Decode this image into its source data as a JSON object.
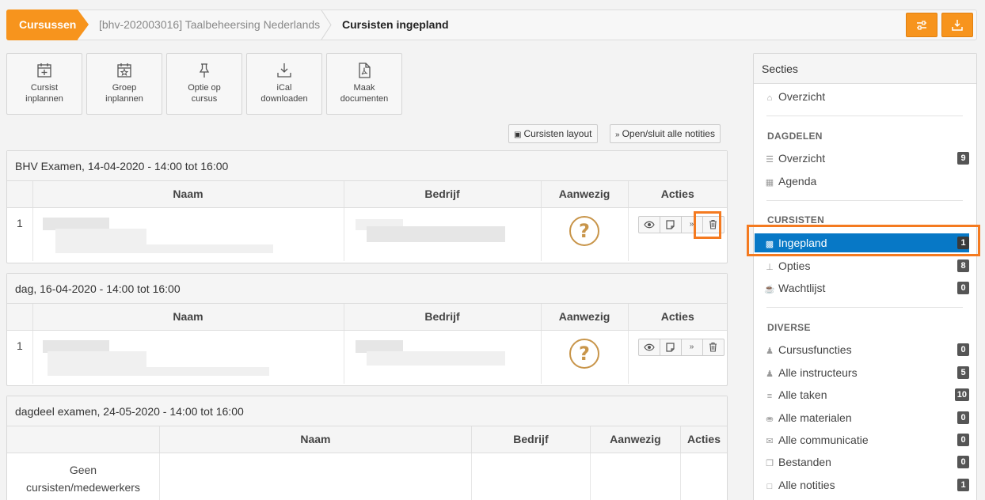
{
  "breadcrumb": {
    "home": "Cursussen",
    "course": "[bhv-202003016] Taalbeheersing Nederlands",
    "current": "Cursisten ingepland"
  },
  "toolbar": [
    {
      "icon": "calendar-plus-icon",
      "line1": "Cursist",
      "line2": "inplannen"
    },
    {
      "icon": "calendar-star-icon",
      "line1": "Groep",
      "line2": "inplannen"
    },
    {
      "icon": "pin-icon",
      "line1": "Optie op",
      "line2": "cursus"
    },
    {
      "icon": "download-icon",
      "line1": "iCal",
      "line2": "downloaden"
    },
    {
      "icon": "pdf-icon",
      "line1": "Maak",
      "line2": "documenten"
    }
  ],
  "actions": {
    "layout": "Cursisten layout",
    "notes": "Open/sluit alle notities"
  },
  "table_headers": {
    "name": "Naam",
    "company": "Bedrijf",
    "present": "Aanwezig",
    "actions": "Acties"
  },
  "sections": [
    {
      "title": "BHV Examen, 14-04-2020 - 14:00 tot 16:00",
      "row_index": "1",
      "present_symbol": "?"
    },
    {
      "title": "dag, 16-04-2020 - 14:00 tot 16:00",
      "row_index": "1",
      "present_symbol": "?"
    },
    {
      "title": "dagdeel examen, 24-05-2020 - 14:00 tot 16:00",
      "empty_text": "Geen cursisten/medewerkers"
    }
  ],
  "sidebar": {
    "title": "Secties",
    "overview": "Overzicht",
    "cat_dagdelen": "DAGDELEN",
    "dagdelen": [
      {
        "label": "Overzicht",
        "badge": "9",
        "icon": "list-icon"
      },
      {
        "label": "Agenda",
        "icon": "calendar-icon"
      }
    ],
    "cat_cursisten": "CURSISTEN",
    "cursisten": [
      {
        "label": "Ingepland",
        "badge": "1",
        "icon": "id-badge-icon"
      },
      {
        "label": "Opties",
        "badge": "8",
        "icon": "pin-icon"
      },
      {
        "label": "Wachtlijst",
        "badge": "0",
        "icon": "mug-icon"
      }
    ],
    "cat_diverse": "DIVERSE",
    "diverse": [
      {
        "label": "Cursusfuncties",
        "badge": "0",
        "icon": "users-icon"
      },
      {
        "label": "Alle instructeurs",
        "badge": "5",
        "icon": "user-icon"
      },
      {
        "label": "Alle taken",
        "badge": "10",
        "icon": "tasks-icon"
      },
      {
        "label": "Alle materialen",
        "badge": "0",
        "icon": "truck-icon"
      },
      {
        "label": "Alle communicatie",
        "badge": "0",
        "icon": "envelope-icon"
      },
      {
        "label": "Bestanden",
        "badge": "0",
        "icon": "files-icon"
      },
      {
        "label": "Alle notities",
        "badge": "1",
        "icon": "note-icon"
      }
    ]
  },
  "colors": {
    "accent": "#f7941d",
    "active": "#0778c6",
    "highlight": "#f47a20",
    "question": "#c8954a"
  }
}
